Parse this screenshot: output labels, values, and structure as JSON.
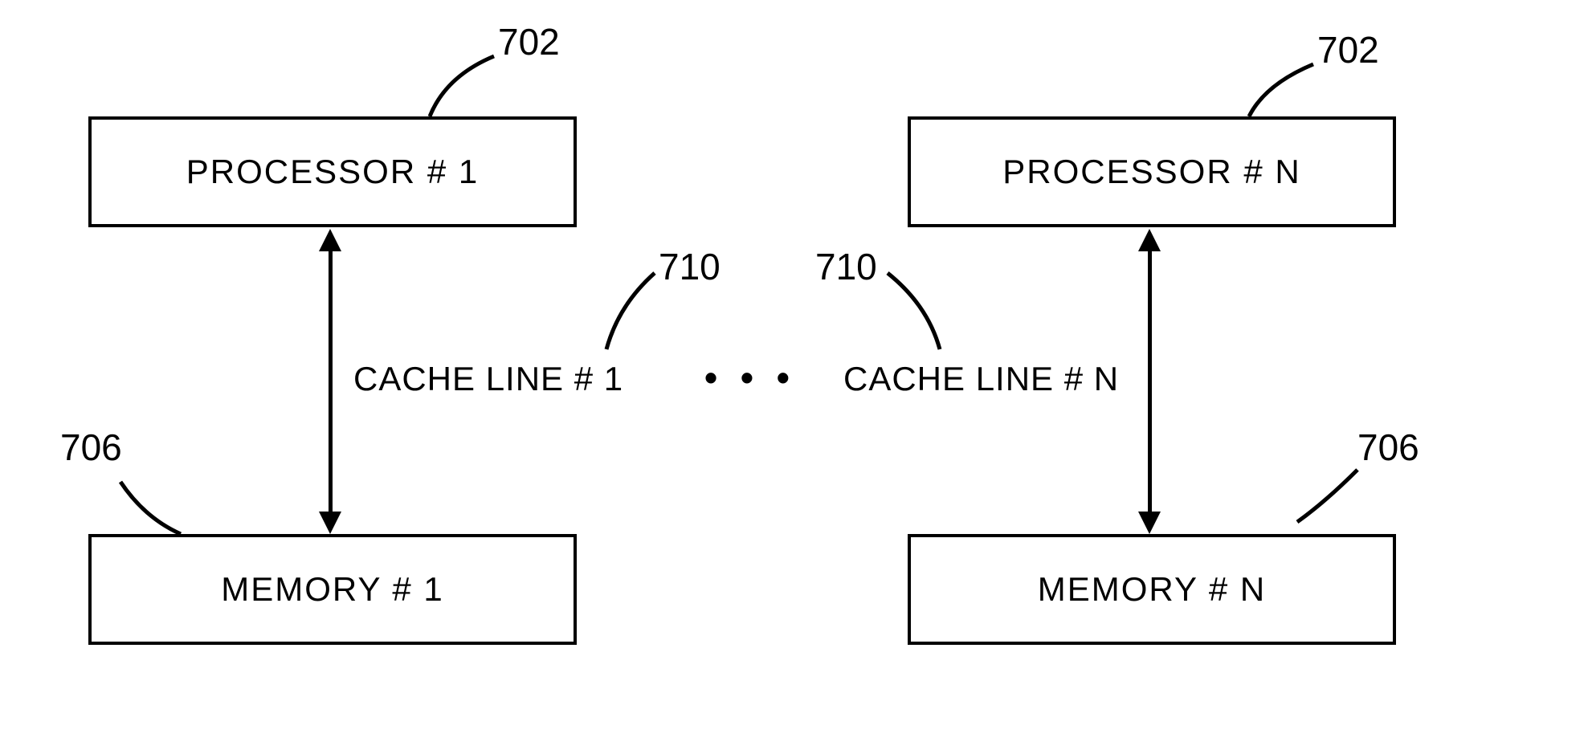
{
  "refs": {
    "proc1": "702",
    "procN": "702",
    "cache1": "710",
    "cacheN": "710",
    "mem1": "706",
    "memN": "706"
  },
  "boxes": {
    "proc1": "PROCESSOR  # 1",
    "procN": "PROCESSOR  # N",
    "mem1": "MEMORY  # 1",
    "memN": "MEMORY  # N"
  },
  "lines": {
    "cache1": "CACHE LINE # 1",
    "cacheN": "CACHE LINE # N",
    "ellipsis": "•  •  •"
  }
}
